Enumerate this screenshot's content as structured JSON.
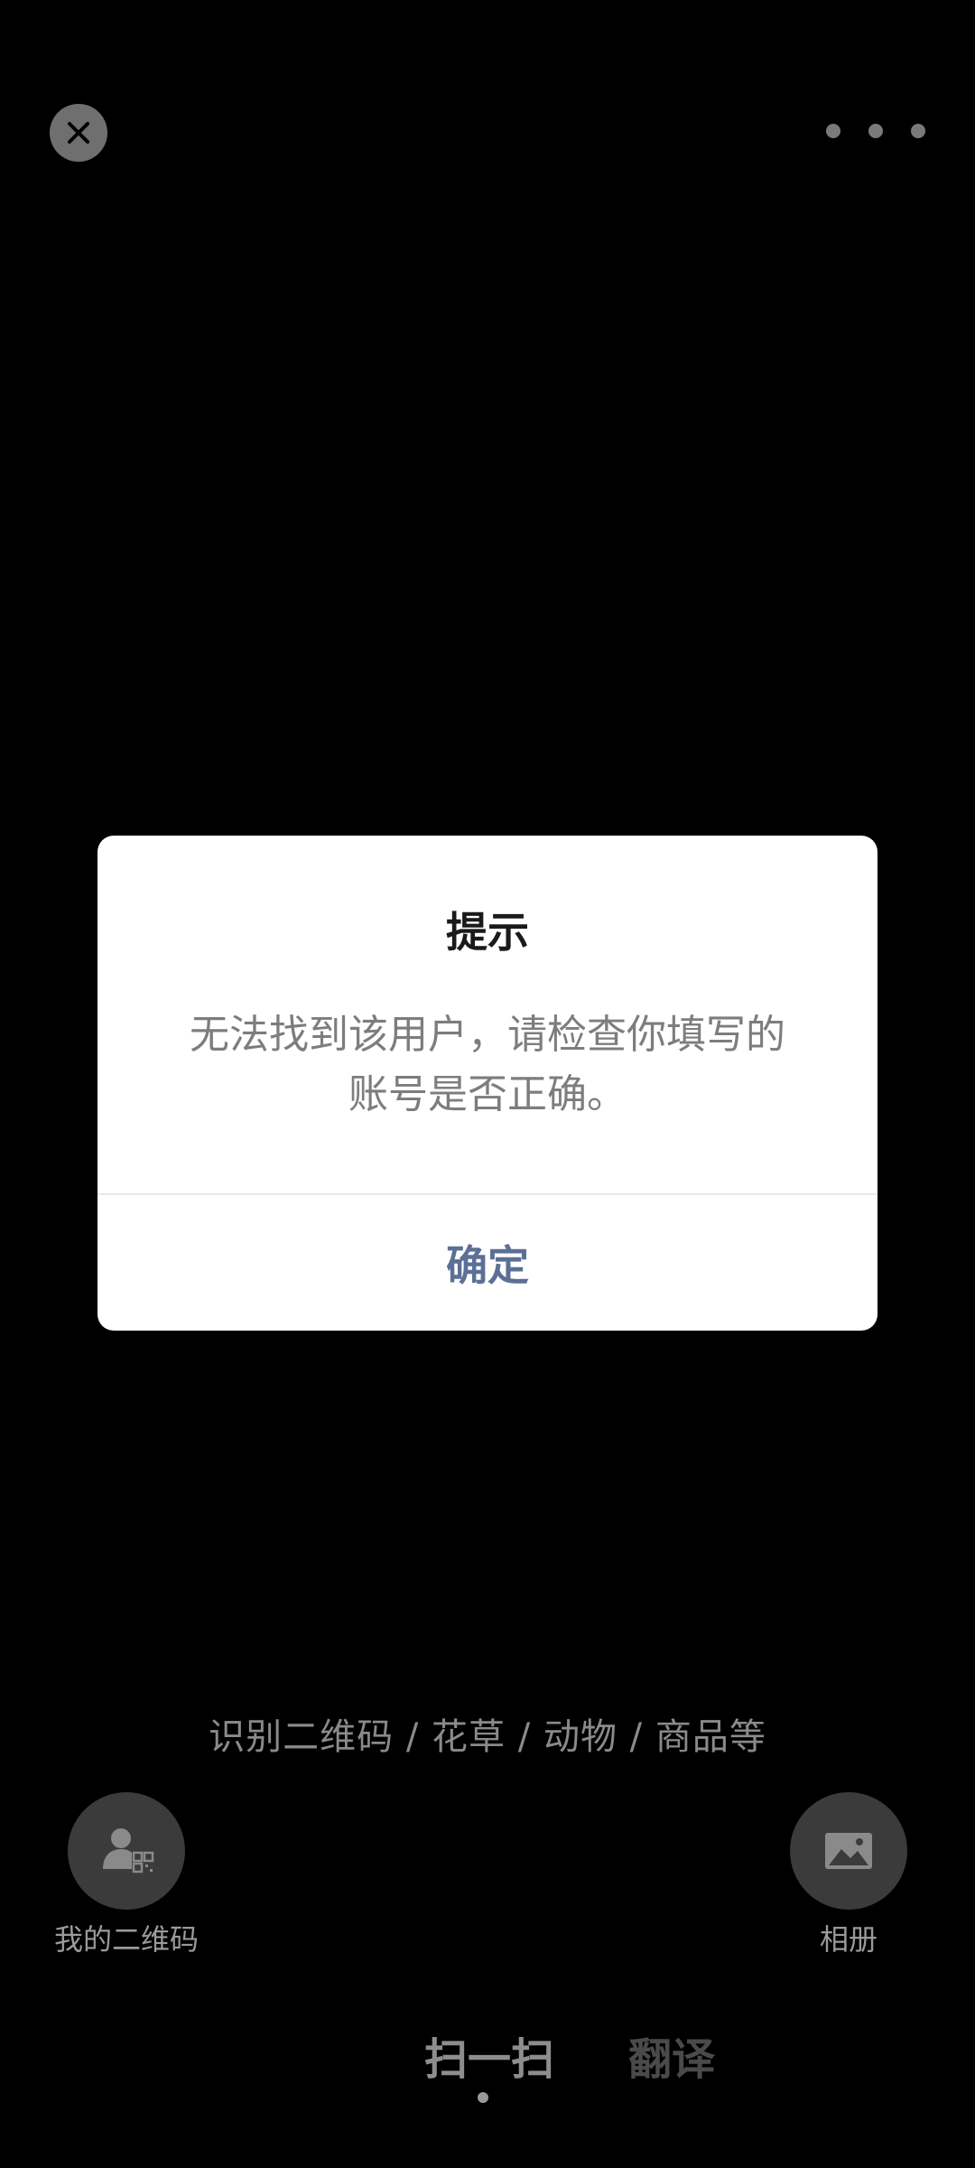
{
  "topbar": {
    "close_icon": "close-icon",
    "more_icon": "more-horizontal-icon"
  },
  "dialog": {
    "title": "提示",
    "message_line1": "无法找到该用户，请检查你填写的",
    "message_line2": "账号是否正确。",
    "confirm_label": "确定",
    "confirm_color": "#5c6f95"
  },
  "scanner": {
    "hint": "识别二维码 / 花草 / 动物 / 商品等",
    "my_qr_label": "我的二维码",
    "album_label": "相册"
  },
  "tabs": [
    {
      "label": "扫一扫",
      "active": true
    },
    {
      "label": "翻译",
      "active": false
    }
  ]
}
